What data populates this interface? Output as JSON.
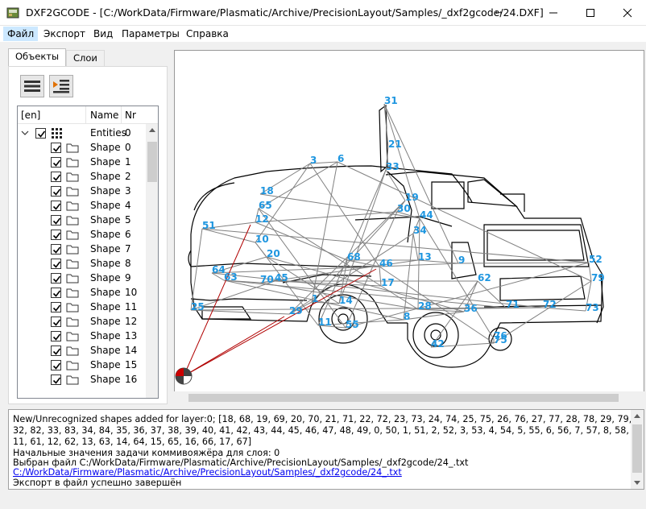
{
  "window": {
    "title": "DXF2GCODE - [C:/WorkData/Firmware/Plasmatic/Archive/PrecisionLayout/Samples/_dxf2gcode/24.DXF]"
  },
  "menu": [
    "Файл",
    "Экспорт",
    "Вид",
    "Параметры",
    "Справка"
  ],
  "tabs": [
    "Объекты",
    "Слои"
  ],
  "tree": {
    "headers": [
      "[en]",
      "Name",
      "Nr"
    ],
    "entities": {
      "name": "Entities",
      "nr": "0"
    },
    "shapes": [
      {
        "name": "Shape",
        "nr": "0"
      },
      {
        "name": "Shape",
        "nr": "1"
      },
      {
        "name": "Shape",
        "nr": "2"
      },
      {
        "name": "Shape",
        "nr": "3"
      },
      {
        "name": "Shape",
        "nr": "4"
      },
      {
        "name": "Shape",
        "nr": "5"
      },
      {
        "name": "Shape",
        "nr": "6"
      },
      {
        "name": "Shape",
        "nr": "7"
      },
      {
        "name": "Shape",
        "nr": "8"
      },
      {
        "name": "Shape",
        "nr": "9"
      },
      {
        "name": "Shape",
        "nr": "10"
      },
      {
        "name": "Shape",
        "nr": "11"
      },
      {
        "name": "Shape",
        "nr": "12"
      },
      {
        "name": "Shape",
        "nr": "13"
      },
      {
        "name": "Shape",
        "nr": "14"
      },
      {
        "name": "Shape",
        "nr": "15"
      },
      {
        "name": "Shape",
        "nr": "16"
      }
    ]
  },
  "canvas": {
    "labels": [
      {
        "t": "31"
      },
      {
        "t": "21"
      },
      {
        "t": "33"
      },
      {
        "t": "19"
      },
      {
        "t": "30"
      },
      {
        "t": "44"
      },
      {
        "t": "34"
      },
      {
        "t": "13"
      },
      {
        "t": "9"
      },
      {
        "t": "52"
      },
      {
        "t": "79"
      },
      {
        "t": "73"
      },
      {
        "t": "72"
      },
      {
        "t": "71"
      },
      {
        "t": "62"
      },
      {
        "t": "42"
      },
      {
        "t": "75"
      },
      {
        "t": "76"
      },
      {
        "t": "3"
      },
      {
        "t": "6"
      },
      {
        "t": "18"
      },
      {
        "t": "65"
      },
      {
        "t": "12"
      },
      {
        "t": "51"
      },
      {
        "t": "10"
      },
      {
        "t": "20"
      },
      {
        "t": "64"
      },
      {
        "t": "63"
      },
      {
        "t": "70"
      },
      {
        "t": "45"
      },
      {
        "t": "25"
      },
      {
        "t": "29"
      },
      {
        "t": "1"
      },
      {
        "t": "14"
      },
      {
        "t": "68"
      },
      {
        "t": "46"
      },
      {
        "t": "17"
      },
      {
        "t": "28"
      },
      {
        "t": "36"
      },
      {
        "t": "8"
      },
      {
        "t": "11"
      },
      {
        "t": "55"
      }
    ]
  },
  "log": {
    "lines": [
      "New/Unrecognized shapes added for layer:0; [18, 68, 19, 69, 20, 70, 21, 71, 22, 72, 23, 73, 24, 74, 25, 75, 26, 76, 27, 77, 28, 78, 29, 79, 30, 80, 31, 81,",
      "32, 82, 33, 83, 34, 84, 35, 36, 37, 38, 39, 40, 41, 42, 43, 44, 45, 46, 47, 48, 49, 0, 50, 1, 51, 2, 52, 3, 53, 4, 54, 5, 55, 6, 56, 7, 57, 8, 58, 9, 59, 10, 60,",
      "11, 61, 12, 62, 13, 63, 14, 64, 15, 65, 16, 66, 17, 67]",
      "Начальные значения задачи коммивояжёра для слоя: 0",
      "Выбран файл C:/WorkData/Firmware/Plasmatic/Archive/PrecisionLayout/Samples/_dxf2gcode/24_.txt"
    ],
    "link": "C:/WorkData/Firmware/Plasmatic/Archive/PrecisionLayout/Samples/_dxf2gcode/24_.txt",
    "last": "Экспорт в файл успешно завершён"
  },
  "colors": {
    "label": "#1e96e0",
    "path": "#808080",
    "move": "#b00000"
  }
}
